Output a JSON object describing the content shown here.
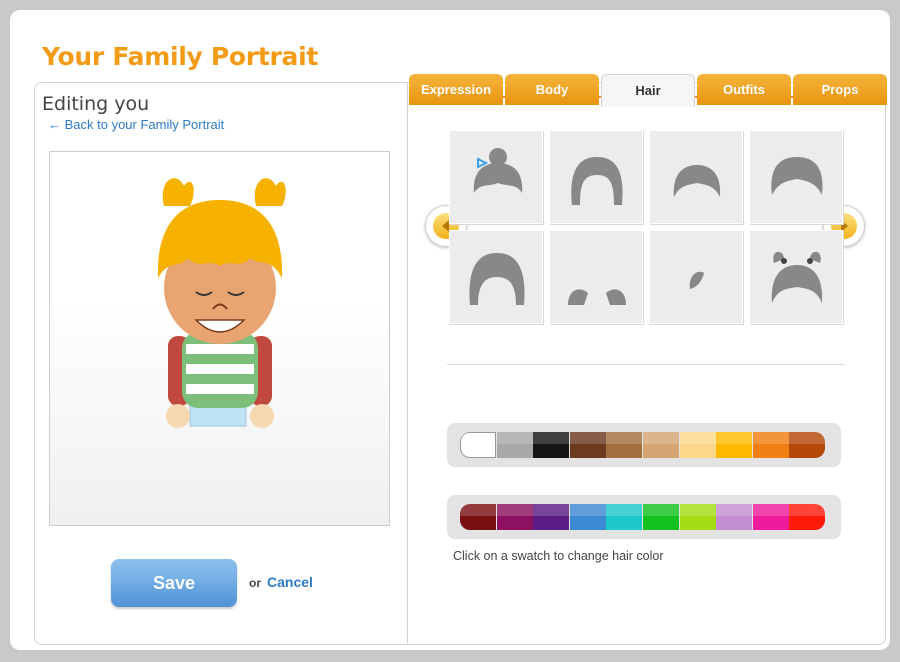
{
  "page": {
    "title": "Your Family Portrait"
  },
  "editor": {
    "heading": "Editing you",
    "back_link": "← Back to your Family Portrait",
    "save_label": "Save",
    "or_text": "or",
    "cancel_label": "Cancel"
  },
  "tabs": [
    {
      "label": "Expression",
      "active": false
    },
    {
      "label": "Body",
      "active": false
    },
    {
      "label": "Hair",
      "active": true
    },
    {
      "label": "Outfits",
      "active": false
    },
    {
      "label": "Props",
      "active": false
    }
  ],
  "hair_styles": [
    {
      "icon": "hair-bun-with-bow-icon"
    },
    {
      "icon": "hair-long-straight-icon"
    },
    {
      "icon": "hair-short-icon"
    },
    {
      "icon": "hair-bob-icon"
    },
    {
      "icon": "hair-bouffant-icon"
    },
    {
      "icon": "hair-side-tufts-icon"
    },
    {
      "icon": "hair-single-tuft-icon"
    },
    {
      "icon": "hair-pigtails-icon"
    }
  ],
  "hair_colors_row1": [
    "#ffffff",
    "#a8a8a8",
    "#151515",
    "#6b3a1f",
    "#a2703f",
    "#d4a572",
    "#fcd98a",
    "#ffba00",
    "#f07f14",
    "#b5490a"
  ],
  "hair_colors_row2": [
    "#7a0f12",
    "#8e1060",
    "#5c1d86",
    "#3d8ad4",
    "#1ec8c8",
    "#14c21f",
    "#a4dd14",
    "#c48fd0",
    "#ee1c9c",
    "#ff1a0a"
  ],
  "selected_color": "#ffffff",
  "hint": "Click on a swatch to change hair color",
  "icons": {
    "prev": "left-arrow-icon",
    "next": "right-arrow-icon"
  },
  "colors": {
    "title": "#f39a16",
    "tab": "#e89410",
    "link": "#2d7cc7"
  }
}
